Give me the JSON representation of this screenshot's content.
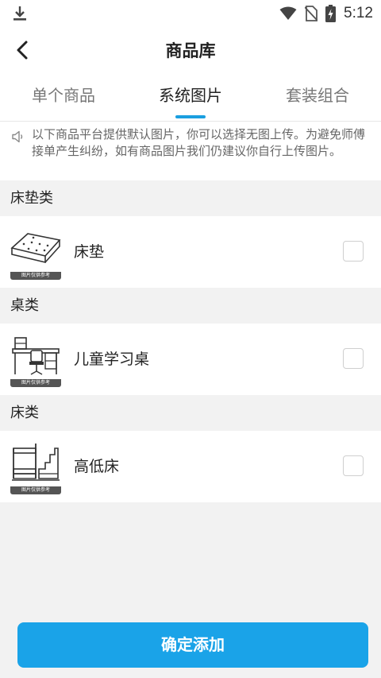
{
  "status_bar": {
    "time": "5:12",
    "icons": [
      "download-icon",
      "wifi-icon",
      "no-sim-icon",
      "battery-charging-icon"
    ]
  },
  "header": {
    "title": "商品库",
    "back_icon": "chevron-left-icon"
  },
  "tabs": [
    {
      "label": "单个商品",
      "active": false
    },
    {
      "label": "系统图片",
      "active": true
    },
    {
      "label": "套装组合",
      "active": false
    }
  ],
  "notice": {
    "icon": "speaker-icon",
    "text": "以下商品平台提供默认图片，你可以选择无图上传。为避免师傅接单产生纠纷，如有商品图片我们仍建议你自行上传图片。"
  },
  "sections": [
    {
      "title": "床垫类",
      "items": [
        {
          "name": "床垫",
          "thumb_caption": "图片仅供参考",
          "checked": false
        }
      ]
    },
    {
      "title": "桌类",
      "items": [
        {
          "name": "儿童学习桌",
          "thumb_caption": "图片仅供参考",
          "checked": false
        }
      ]
    },
    {
      "title": "床类",
      "items": [
        {
          "name": "高低床",
          "thumb_caption": "图片仅供参考",
          "checked": false
        }
      ]
    }
  ],
  "confirm_button": {
    "label": "确定添加"
  },
  "colors": {
    "accent": "#1aa3e8",
    "indicator": "#1a9fe0",
    "background": "#f2f2f2"
  }
}
